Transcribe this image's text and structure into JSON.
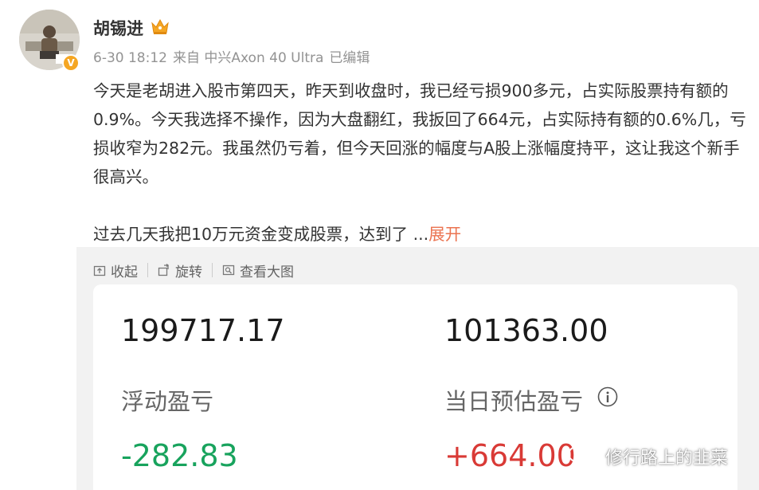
{
  "post": {
    "author": "胡锡进",
    "meta": {
      "datetime": "6-30 18:12",
      "source": "来自 中兴Axon 40 Ultra",
      "edited": "已编辑"
    },
    "body_para1": "今天是老胡进入股市第四天，昨天到收盘时，我已经亏损900多元，占实际股票持有额的0.9%。今天我选择不操作，因为大盘翻红，我扳回了664元，占实际持有额的0.6%几，亏损收窄为282元。我虽然仍亏着，但今天回涨的幅度与A股上涨幅度持平，这让我这个新手很高兴。",
    "body_para2": "过去几天我把10万元资金变成股票，达到了 ...",
    "expand_label": "展开"
  },
  "toolbar": {
    "collapse_label": "收起",
    "rotate_label": "旋转",
    "view_large_label": "查看大图"
  },
  "stock_card": {
    "total_assets": "199717.17",
    "market_value": "101363.00",
    "floating_pl_label": "浮动盈亏",
    "floating_pl_value": "-282.83",
    "daily_pl_label": "当日预估盈亏",
    "daily_pl_value": "+664.00"
  },
  "watermark": "修行路上的韭菜",
  "colors": {
    "link": "#eb7350",
    "loss": "#18a35d",
    "gain": "#d93a36",
    "badge": "#f5a623"
  }
}
